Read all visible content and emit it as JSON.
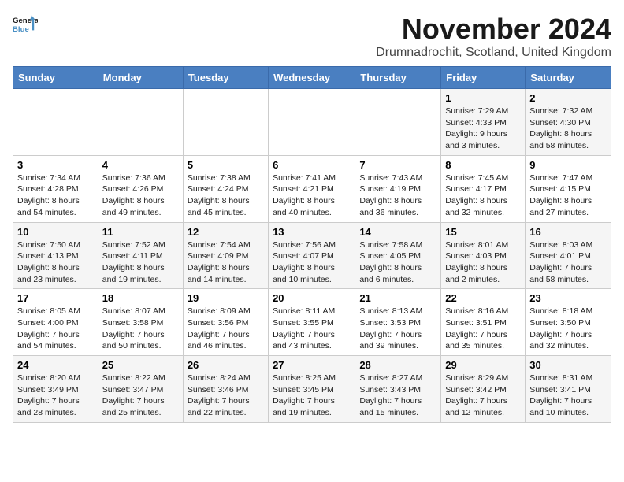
{
  "logo": {
    "line1": "General",
    "line2": "Blue"
  },
  "title": "November 2024",
  "location": "Drumnadrochit, Scotland, United Kingdom",
  "days_of_week": [
    "Sunday",
    "Monday",
    "Tuesday",
    "Wednesday",
    "Thursday",
    "Friday",
    "Saturday"
  ],
  "weeks": [
    [
      {
        "day": "",
        "info": ""
      },
      {
        "day": "",
        "info": ""
      },
      {
        "day": "",
        "info": ""
      },
      {
        "day": "",
        "info": ""
      },
      {
        "day": "",
        "info": ""
      },
      {
        "day": "1",
        "info": "Sunrise: 7:29 AM\nSunset: 4:33 PM\nDaylight: 9 hours\nand 3 minutes."
      },
      {
        "day": "2",
        "info": "Sunrise: 7:32 AM\nSunset: 4:30 PM\nDaylight: 8 hours\nand 58 minutes."
      }
    ],
    [
      {
        "day": "3",
        "info": "Sunrise: 7:34 AM\nSunset: 4:28 PM\nDaylight: 8 hours\nand 54 minutes."
      },
      {
        "day": "4",
        "info": "Sunrise: 7:36 AM\nSunset: 4:26 PM\nDaylight: 8 hours\nand 49 minutes."
      },
      {
        "day": "5",
        "info": "Sunrise: 7:38 AM\nSunset: 4:24 PM\nDaylight: 8 hours\nand 45 minutes."
      },
      {
        "day": "6",
        "info": "Sunrise: 7:41 AM\nSunset: 4:21 PM\nDaylight: 8 hours\nand 40 minutes."
      },
      {
        "day": "7",
        "info": "Sunrise: 7:43 AM\nSunset: 4:19 PM\nDaylight: 8 hours\nand 36 minutes."
      },
      {
        "day": "8",
        "info": "Sunrise: 7:45 AM\nSunset: 4:17 PM\nDaylight: 8 hours\nand 32 minutes."
      },
      {
        "day": "9",
        "info": "Sunrise: 7:47 AM\nSunset: 4:15 PM\nDaylight: 8 hours\nand 27 minutes."
      }
    ],
    [
      {
        "day": "10",
        "info": "Sunrise: 7:50 AM\nSunset: 4:13 PM\nDaylight: 8 hours\nand 23 minutes."
      },
      {
        "day": "11",
        "info": "Sunrise: 7:52 AM\nSunset: 4:11 PM\nDaylight: 8 hours\nand 19 minutes."
      },
      {
        "day": "12",
        "info": "Sunrise: 7:54 AM\nSunset: 4:09 PM\nDaylight: 8 hours\nand 14 minutes."
      },
      {
        "day": "13",
        "info": "Sunrise: 7:56 AM\nSunset: 4:07 PM\nDaylight: 8 hours\nand 10 minutes."
      },
      {
        "day": "14",
        "info": "Sunrise: 7:58 AM\nSunset: 4:05 PM\nDaylight: 8 hours\nand 6 minutes."
      },
      {
        "day": "15",
        "info": "Sunrise: 8:01 AM\nSunset: 4:03 PM\nDaylight: 8 hours\nand 2 minutes."
      },
      {
        "day": "16",
        "info": "Sunrise: 8:03 AM\nSunset: 4:01 PM\nDaylight: 7 hours\nand 58 minutes."
      }
    ],
    [
      {
        "day": "17",
        "info": "Sunrise: 8:05 AM\nSunset: 4:00 PM\nDaylight: 7 hours\nand 54 minutes."
      },
      {
        "day": "18",
        "info": "Sunrise: 8:07 AM\nSunset: 3:58 PM\nDaylight: 7 hours\nand 50 minutes."
      },
      {
        "day": "19",
        "info": "Sunrise: 8:09 AM\nSunset: 3:56 PM\nDaylight: 7 hours\nand 46 minutes."
      },
      {
        "day": "20",
        "info": "Sunrise: 8:11 AM\nSunset: 3:55 PM\nDaylight: 7 hours\nand 43 minutes."
      },
      {
        "day": "21",
        "info": "Sunrise: 8:13 AM\nSunset: 3:53 PM\nDaylight: 7 hours\nand 39 minutes."
      },
      {
        "day": "22",
        "info": "Sunrise: 8:16 AM\nSunset: 3:51 PM\nDaylight: 7 hours\nand 35 minutes."
      },
      {
        "day": "23",
        "info": "Sunrise: 8:18 AM\nSunset: 3:50 PM\nDaylight: 7 hours\nand 32 minutes."
      }
    ],
    [
      {
        "day": "24",
        "info": "Sunrise: 8:20 AM\nSunset: 3:49 PM\nDaylight: 7 hours\nand 28 minutes."
      },
      {
        "day": "25",
        "info": "Sunrise: 8:22 AM\nSunset: 3:47 PM\nDaylight: 7 hours\nand 25 minutes."
      },
      {
        "day": "26",
        "info": "Sunrise: 8:24 AM\nSunset: 3:46 PM\nDaylight: 7 hours\nand 22 minutes."
      },
      {
        "day": "27",
        "info": "Sunrise: 8:25 AM\nSunset: 3:45 PM\nDaylight: 7 hours\nand 19 minutes."
      },
      {
        "day": "28",
        "info": "Sunrise: 8:27 AM\nSunset: 3:43 PM\nDaylight: 7 hours\nand 15 minutes."
      },
      {
        "day": "29",
        "info": "Sunrise: 8:29 AM\nSunset: 3:42 PM\nDaylight: 7 hours\nand 12 minutes."
      },
      {
        "day": "30",
        "info": "Sunrise: 8:31 AM\nSunset: 3:41 PM\nDaylight: 7 hours\nand 10 minutes."
      }
    ]
  ]
}
